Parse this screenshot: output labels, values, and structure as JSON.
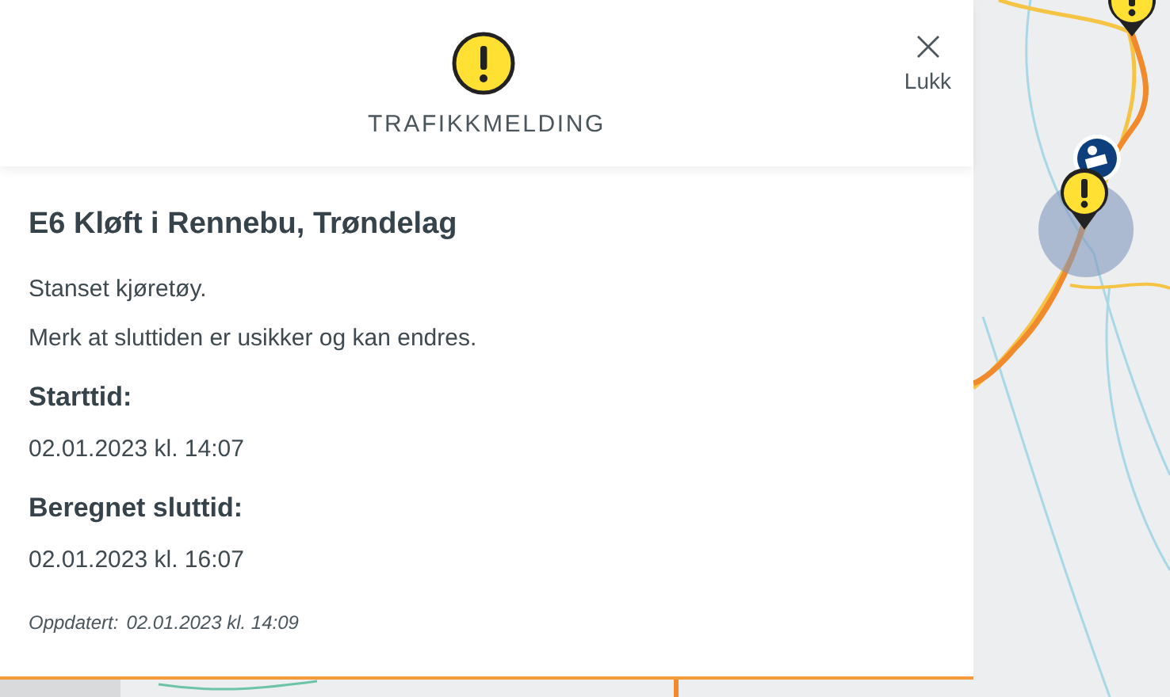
{
  "header": {
    "title": "TRAFIKKMELDING",
    "close_label": "Lukk"
  },
  "incident": {
    "title": "E6 Kløft i Rennebu, Trøndelag",
    "description": [
      "Stanset kjøretøy.",
      "Merk at sluttiden er usikker og kan endres."
    ],
    "fields": [
      {
        "label": "Starttid:",
        "value": "02.01.2023 kl. 14:07"
      },
      {
        "label": "Beregnet sluttid:",
        "value": "02.01.2023 kl. 16:07"
      }
    ],
    "updated_label": "Oppdatert:",
    "updated_value": "02.01.2023 kl. 14:09"
  }
}
